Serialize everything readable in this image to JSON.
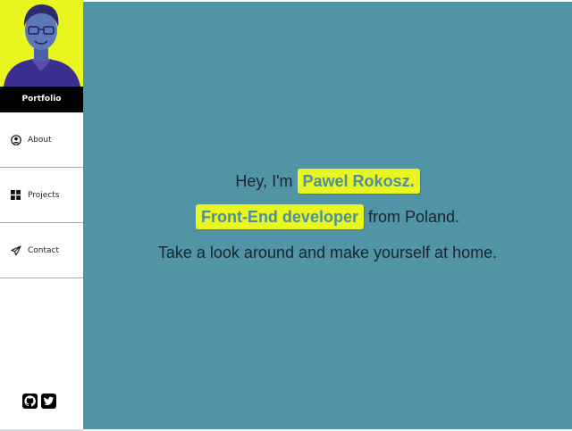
{
  "sidebar": {
    "brand": "Portfolio",
    "nav": [
      {
        "label": "About",
        "icon": "user-circle-icon"
      },
      {
        "label": "Projects",
        "icon": "grid-icon"
      },
      {
        "label": "Contact",
        "icon": "paper-plane-icon"
      }
    ],
    "social": [
      {
        "icon": "github-icon"
      },
      {
        "icon": "twitter-icon"
      }
    ]
  },
  "intro": {
    "greeting": "Hey, I'm",
    "name": "Pawel Rokosz.",
    "role": "Front-End developer",
    "origin": "from Poland.",
    "tagline": "Take a look around and make yourself at home."
  },
  "colors": {
    "accent": "#e9f51f",
    "main_bg": "#5194a5",
    "text": "#1c2330"
  }
}
